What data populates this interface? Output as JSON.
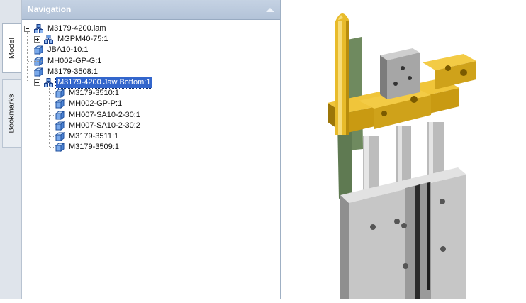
{
  "tabs": [
    {
      "label": "Model",
      "active": true
    },
    {
      "label": "Bookmarks",
      "active": false
    }
  ],
  "navigation": {
    "title": "Navigation",
    "tree": [
      {
        "label": "M3179-4200.iam",
        "icon": "assembly-icon",
        "expander": "minus",
        "level": 0
      },
      {
        "label": "MGPM40-75:1",
        "icon": "assembly-icon",
        "expander": "plus",
        "level": 1
      },
      {
        "label": "JBA10-10:1",
        "icon": "part-icon",
        "level": 1
      },
      {
        "label": "MH002-GP-G:1",
        "icon": "part-icon",
        "level": 1
      },
      {
        "label": "M3179-3508:1",
        "icon": "part-icon",
        "level": 1
      },
      {
        "label": "M3179-4200 Jaw Bottom:1",
        "icon": "assembly-icon",
        "expander": "minus",
        "level": 1,
        "selected": true
      },
      {
        "label": "M3179-3510:1",
        "icon": "part-icon",
        "level": 2
      },
      {
        "label": "MH002-GP-P:1",
        "icon": "part-icon",
        "level": 2
      },
      {
        "label": "MH007-SA10-2-30:1",
        "icon": "part-icon",
        "level": 2
      },
      {
        "label": "MH007-SA10-2-30:2",
        "icon": "part-icon",
        "level": 2
      },
      {
        "label": "M3179-3511:1",
        "icon": "part-icon",
        "level": 2
      },
      {
        "label": "M3179-3509:1",
        "icon": "part-icon",
        "level": 2
      }
    ]
  },
  "viewport": {
    "model_colors": {
      "gold": "#e0b21c",
      "steel": "#c4c4c4",
      "rod": "#bcbcbc",
      "dark": "#5a5a5a",
      "green": "#6f8a5f"
    }
  }
}
